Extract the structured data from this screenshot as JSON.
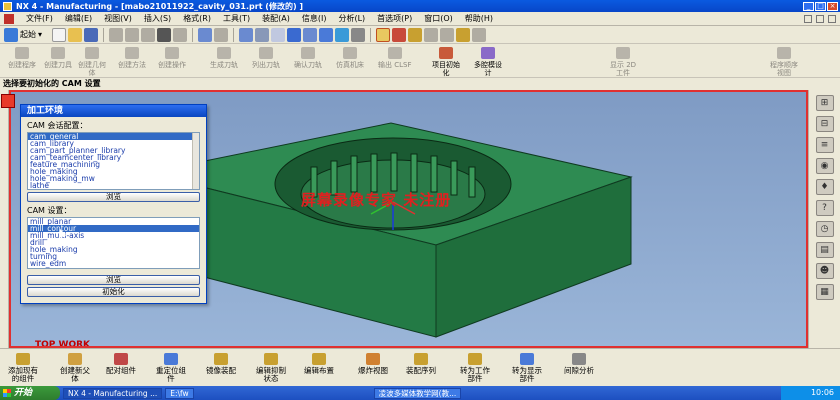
{
  "window": {
    "title": "NX 4 - Manufacturing - [mabo21011922_cavity_031.prt (修改的) ]",
    "controls": [
      "_",
      "□",
      "×"
    ]
  },
  "menubar": {
    "items": [
      "文件(F)",
      "编辑(E)",
      "视图(V)",
      "插入(S)",
      "格式(R)",
      "工具(T)",
      "装配(A)",
      "信息(I)",
      "分析(L)",
      "首选项(P)",
      "窗口(O)",
      "帮助(H)"
    ]
  },
  "toolbar1": {
    "start_label": "起始"
  },
  "toolbar2": {
    "buttons": [
      {
        "label": "创建程序"
      },
      {
        "label": "创建刀具"
      },
      {
        "label": "创建几何\n体"
      },
      {
        "label": "创建方法"
      },
      {
        "label": "创建操作"
      },
      {
        "label": "生成刀轨"
      },
      {
        "label": "列出刀轨"
      },
      {
        "label": "确认刀轨"
      },
      {
        "label": "仿真机床"
      },
      {
        "label": "输出 CLSF"
      },
      {
        "label": "项目初始\n化"
      },
      {
        "label": "多腔模设\n计"
      },
      {
        "label": "显示 2D\n工件"
      },
      {
        "label": "程序顺序\n视图"
      }
    ]
  },
  "hint": "选择要初始化的 CAM 设置",
  "viewport": {
    "view_label": "TOP WORK",
    "watermark": "屏幕录像专家  未注册"
  },
  "dialog": {
    "title": "加工环境",
    "session_label": "CAM 会话配置：",
    "session_items": [
      "cam_general",
      "cam_library",
      "cam_part_planner_library",
      "cam_teamcenter_library",
      "feature_machining",
      "hole_making",
      "hole_making_mw",
      "lathe"
    ],
    "session_selected": 0,
    "browse1": "浏览",
    "setup_label": "CAM 设置：",
    "setup_items": [
      "mill_planar",
      "mill_contour",
      "mill_multi-axis",
      "drill",
      "hole_making",
      "turning",
      "wire_edm"
    ],
    "setup_selected": 1,
    "browse2": "浏览",
    "init_button": "初始化"
  },
  "bottom_toolbar": {
    "buttons": [
      {
        "label": "添加现有\n的组件"
      },
      {
        "label": "创建新父\n体"
      },
      {
        "label": "配对组件"
      },
      {
        "label": "重定位组\n件"
      },
      {
        "label": "镜像装配"
      },
      {
        "label": "编辑抑制\n状态"
      },
      {
        "label": "编辑布置"
      },
      {
        "label": "爆炸视图"
      },
      {
        "label": "装配序列"
      },
      {
        "label": "转为工作\n部件"
      },
      {
        "label": "转为显示\n部件"
      },
      {
        "label": "间隙分析"
      }
    ]
  },
  "taskbar": {
    "start": "开始",
    "items": [
      "NX 4 - Manufacturing ...",
      "E:\\fw",
      "凌波多媒体教学网(教..."
    ],
    "clock": "10:06"
  },
  "colors": {
    "part_face": "#2e8b52",
    "part_side": "#1f6e3c",
    "part_front": "#237a45",
    "viewport_bg": "#8fa9cf",
    "border_highlight": "#e03030"
  }
}
